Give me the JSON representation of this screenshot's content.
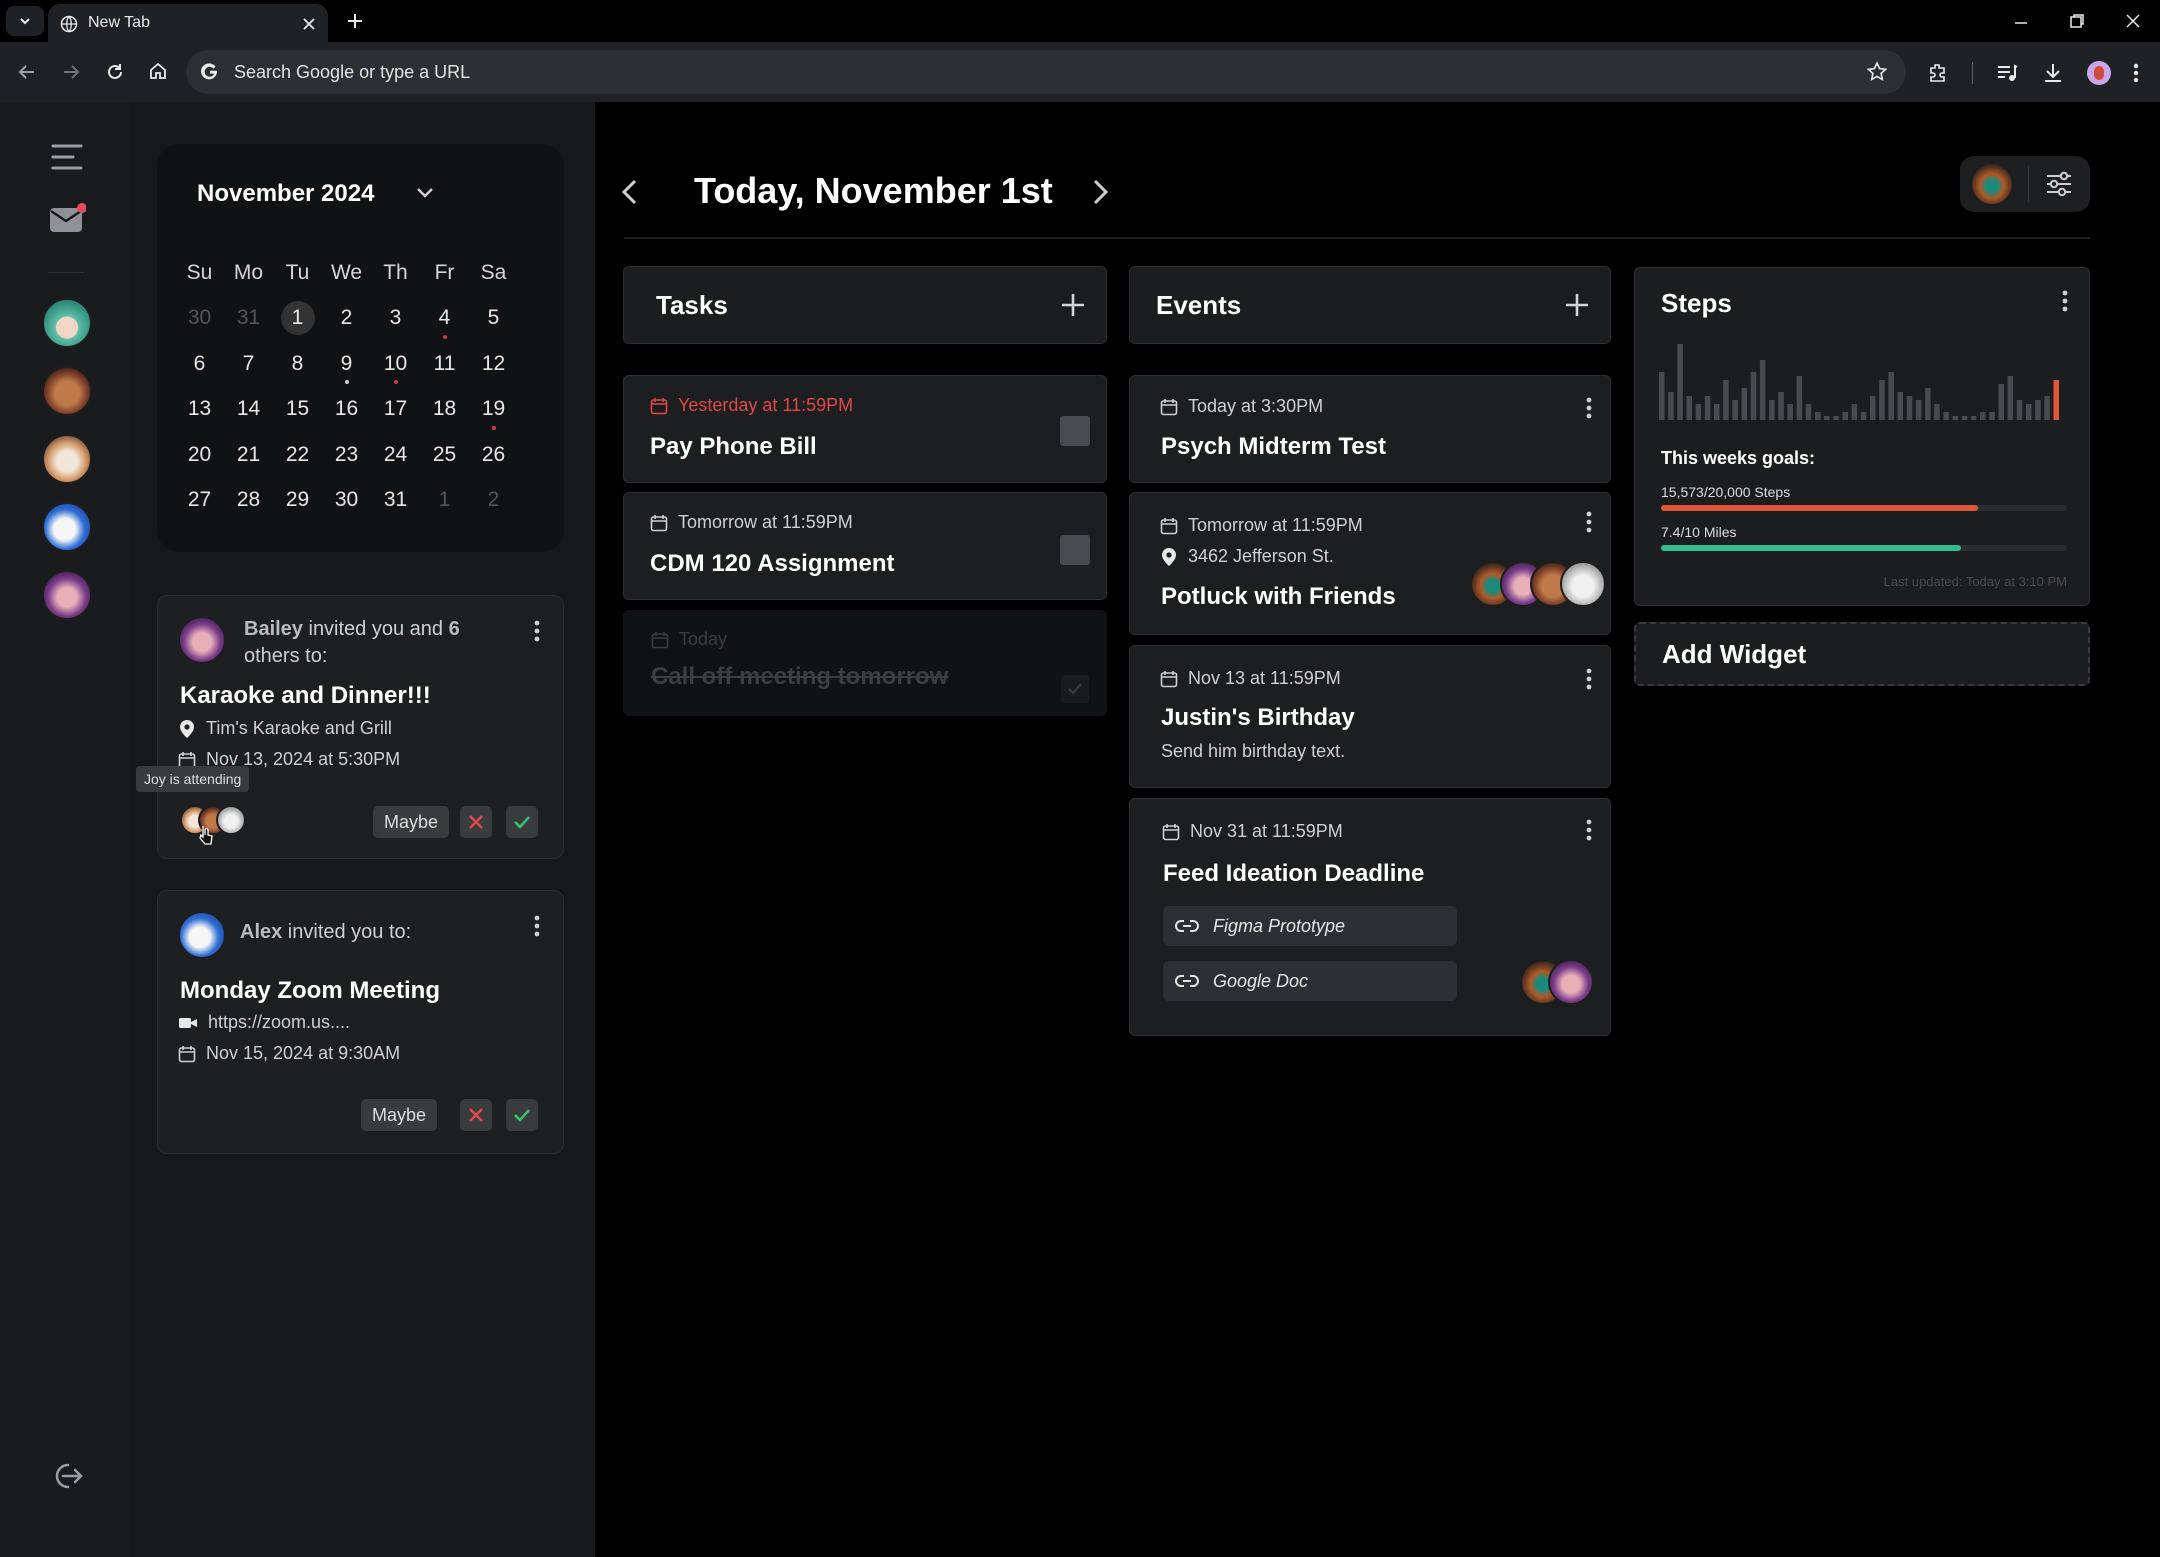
{
  "browser": {
    "tab_title": "New Tab",
    "url_placeholder": "Search Google or type a URL"
  },
  "calendar": {
    "month_label": "November 2024",
    "weekdays": [
      "Su",
      "Mo",
      "Tu",
      "We",
      "Th",
      "Fr",
      "Sa"
    ],
    "weeks": [
      [
        "30",
        "31",
        "1",
        "2",
        "3",
        "4",
        "5"
      ],
      [
        "6",
        "7",
        "8",
        "9",
        "10",
        "11",
        "12"
      ],
      [
        "13",
        "14",
        "15",
        "16",
        "17",
        "18",
        "19"
      ],
      [
        "20",
        "21",
        "22",
        "23",
        "24",
        "25",
        "26"
      ],
      [
        "27",
        "28",
        "29",
        "30",
        "31",
        "1",
        "2"
      ]
    ],
    "today": "1"
  },
  "invites": [
    {
      "inviter": "Bailey",
      "message_before": " invited you and ",
      "count": "6",
      "message_after": " others to:",
      "title": "Karaoke and Dinner!!!",
      "location": "Tim's Karaoke and Grill",
      "date": "Nov 13, 2024 at 5:30PM",
      "tooltip": "Joy is attending",
      "maybe": "Maybe"
    },
    {
      "inviter": "Alex",
      "message_before": " invited you to:",
      "title": "Monday Zoom Meeting",
      "link": "https://zoom.us....",
      "date": "Nov 15, 2024 at 9:30AM",
      "maybe": "Maybe"
    }
  ],
  "header": {
    "title": "Today, November 1st"
  },
  "tasks": {
    "heading": "Tasks",
    "items": [
      {
        "due": "Yesterday at 11:59PM",
        "title": "Pay Phone Bill",
        "overdue": true
      },
      {
        "due": "Tomorrow at 11:59PM",
        "title": "CDM 120 Assignment"
      },
      {
        "due": "Today",
        "title": "Call off meeting tomorrow",
        "done": true
      }
    ]
  },
  "events": {
    "heading": "Events",
    "items": [
      {
        "when": "Today at 3:30PM",
        "title": "Psych Midterm Test"
      },
      {
        "when": "Tomorrow at 11:59PM",
        "location": "3462 Jefferson St.",
        "title": "Potluck with Friends"
      },
      {
        "when": "Nov 13 at 11:59PM",
        "title": "Justin's Birthday",
        "note": "Send him birthday text."
      },
      {
        "when": "Nov 31 at 11:59PM",
        "title": "Feed Ideation Deadline",
        "links": [
          "Figma Prototype",
          "Google Doc"
        ]
      }
    ]
  },
  "steps": {
    "heading": "Steps",
    "goals_label": "This weeks goals:",
    "steps_label": "15,573/20,000 Steps",
    "steps_progress": 0.78,
    "miles_label": "7.4/10 Miles",
    "miles_progress": 0.74,
    "updated": "Last updated: Today at 3:10 PM",
    "bars": [
      0.6,
      0.35,
      0.95,
      0.3,
      0.2,
      0.3,
      0.2,
      0.5,
      0.25,
      0.4,
      0.6,
      0.75,
      0.25,
      0.35,
      0.2,
      0.55,
      0.2,
      0.1,
      0.05,
      0.05,
      0.1,
      0.2,
      0.1,
      0.3,
      0.5,
      0.6,
      0.35,
      0.3,
      0.25,
      0.4,
      0.2,
      0.1,
      0.05,
      0.05,
      0.05,
      0.1,
      0.1,
      0.45,
      0.55,
      0.25,
      0.2,
      0.25,
      0.3,
      0.5
    ],
    "accent": "#e0583a",
    "miles_color": "#2fbf8f"
  },
  "add_widget": "Add Widget",
  "colors": {
    "overdue": "#e04848",
    "dot": "#d0384a"
  }
}
